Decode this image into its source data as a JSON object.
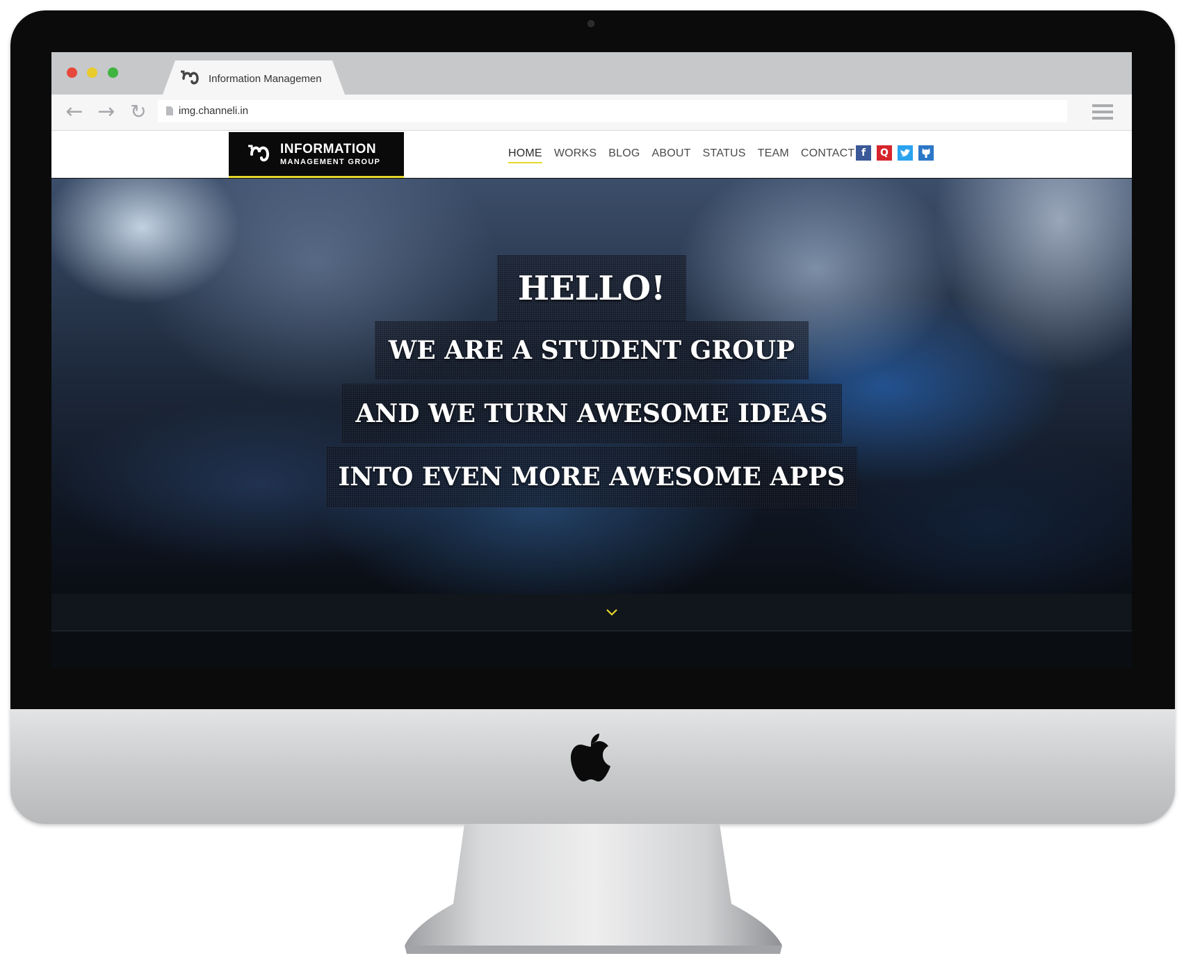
{
  "browser": {
    "tab_title": "Information Managemen",
    "url": "img.channeli.in",
    "nav_icons": {
      "back": "arrow-left-icon",
      "forward": "arrow-right-icon",
      "reload": "reload-icon",
      "menu": "hamburger-menu-icon"
    }
  },
  "site": {
    "brand": {
      "line1": "INFORMATION",
      "line2": "MANAGEMENT GROUP"
    },
    "nav": [
      "HOME",
      "WORKS",
      "BLOG",
      "ABOUT",
      "STATUS",
      "TEAM",
      "CONTACT"
    ],
    "active_nav": "HOME",
    "social": [
      {
        "name": "facebook-icon",
        "glyph": "f",
        "color": "#3b5998"
      },
      {
        "name": "quora-icon",
        "glyph": "Q",
        "color": "#d6252c"
      },
      {
        "name": "twitter-icon",
        "glyph": "t",
        "color": "#2aa3ef"
      },
      {
        "name": "github-icon",
        "glyph": "g",
        "color": "#2c77c7"
      }
    ],
    "hero": {
      "hello": "HELLO!",
      "line2": "WE ARE A STUDENT GROUP",
      "line3": "AND WE TURN AWESOME IDEAS",
      "line4": "INTO EVEN MORE AWESOME APPS"
    },
    "scroll_icon": "chevron-down-icon"
  },
  "colors": {
    "accent_yellow": "#e6d82a",
    "brand_black": "#0a0a0a"
  }
}
